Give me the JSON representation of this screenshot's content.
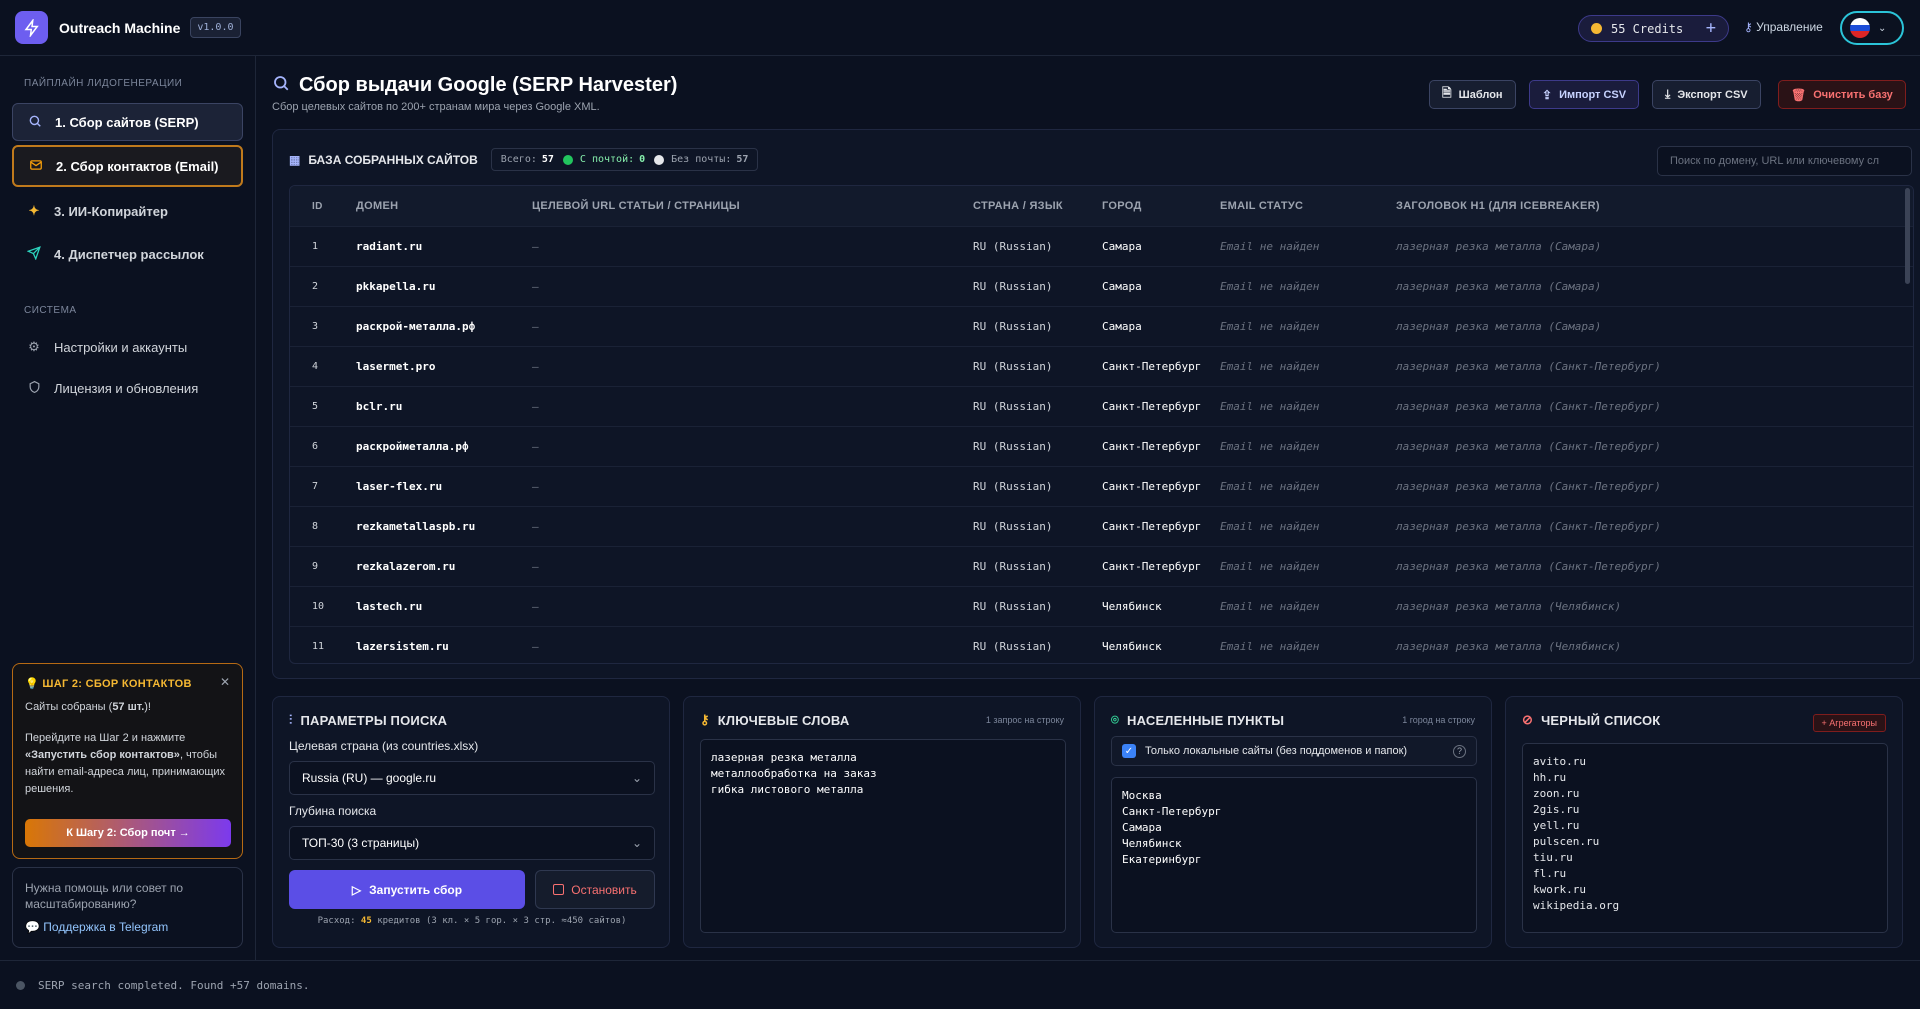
{
  "header": {
    "app_name": "Outreach Machine",
    "version": "v1.0.0",
    "credits": "55 Credits",
    "manage_label": "Управление"
  },
  "sidebar": {
    "pipeline_title": "ПАЙПЛАЙН ЛИДОГЕНЕРАЦИИ",
    "items": [
      {
        "label": "1. Сбор сайтов (SERP)",
        "icon": "search-icon"
      },
      {
        "label": "2. Сбор контактов (Email)",
        "icon": "mail-icon"
      },
      {
        "label": "3. ИИ-Копирайтер",
        "icon": "sparkles-icon"
      },
      {
        "label": "4. Диспетчер рассылок",
        "icon": "send-icon"
      }
    ],
    "system_title": "СИСТЕМА",
    "system_items": [
      {
        "label": "Настройки и аккаунты",
        "icon": "gear-icon"
      },
      {
        "label": "Лицензия и обновления",
        "icon": "shield-icon"
      }
    ],
    "hint": {
      "title": "ШАГ 2: СБОР КОНТАКТОВ",
      "line1": "Сайты собраны (",
      "line1_bold": "57 шт.",
      "line1_end": ")!",
      "line2_a": "Перейдите на Шаг 2 и нажмите ",
      "line2_bold": "«Запустить сбор контактов»",
      "line2_b": ", чтобы найти email-адреса лиц, принимающих решения.",
      "button": "К Шагу 2: Сбор почт →"
    },
    "help": {
      "text": "Нужна помощь или совет по масштабированию?",
      "link": "Поддержка в Telegram"
    }
  },
  "page": {
    "title": "Сбор выдачи Google (SERP Harvester)",
    "subtitle": "Сбор целевых сайтов по 200+ странам мира через Google XML.",
    "buttons": {
      "template": "Шаблон",
      "import": "Импорт CSV",
      "export": "Экспорт CSV",
      "clear": "Очистить базу"
    }
  },
  "table": {
    "title": "БАЗА СОБРАННЫХ САЙТОВ",
    "total_label": "Всего:",
    "total": "57",
    "with_email_label": "С почтой:",
    "with_email": "0",
    "no_email_label": "Без почты:",
    "no_email": "57",
    "search_placeholder": "Поиск по домену, URL или ключевому сл",
    "columns": [
      "ID",
      "ДОМЕН",
      "ЦЕЛЕВОЙ URL СТАТЬИ / СТРАНИЦЫ",
      "СТРАНА / ЯЗЫК",
      "ГОРОД",
      "EMAIL СТАТУС",
      "ЗАГОЛОВОК H1 (ДЛЯ ICEBREAKER)"
    ],
    "rows": [
      {
        "id": "1",
        "domain": "radiant.ru",
        "url": "—",
        "country": "RU (Russian)",
        "city": "Самара",
        "email": "Email не найден",
        "h1": "лазерная резка металла (Самара)"
      },
      {
        "id": "2",
        "domain": "pkkapella.ru",
        "url": "—",
        "country": "RU (Russian)",
        "city": "Самара",
        "email": "Email не найден",
        "h1": "лазерная резка металла (Самара)"
      },
      {
        "id": "3",
        "domain": "раскрой-металла.рф",
        "url": "—",
        "country": "RU (Russian)",
        "city": "Самара",
        "email": "Email не найден",
        "h1": "лазерная резка металла (Самара)"
      },
      {
        "id": "4",
        "domain": "lasermet.pro",
        "url": "—",
        "country": "RU (Russian)",
        "city": "Санкт-Петербург",
        "email": "Email не найден",
        "h1": "лазерная резка металла (Санкт-Петербург)"
      },
      {
        "id": "5",
        "domain": "bclr.ru",
        "url": "—",
        "country": "RU (Russian)",
        "city": "Санкт-Петербург",
        "email": "Email не найден",
        "h1": "лазерная резка металла (Санкт-Петербург)"
      },
      {
        "id": "6",
        "domain": "раскройметалла.рф",
        "url": "—",
        "country": "RU (Russian)",
        "city": "Санкт-Петербург",
        "email": "Email не найден",
        "h1": "лазерная резка металла (Санкт-Петербург)"
      },
      {
        "id": "7",
        "domain": "laser-flex.ru",
        "url": "—",
        "country": "RU (Russian)",
        "city": "Санкт-Петербург",
        "email": "Email не найден",
        "h1": "лазерная резка металла (Санкт-Петербург)"
      },
      {
        "id": "8",
        "domain": "rezkametallaspb.ru",
        "url": "—",
        "country": "RU (Russian)",
        "city": "Санкт-Петербург",
        "email": "Email не найден",
        "h1": "лазерная резка металла (Санкт-Петербург)"
      },
      {
        "id": "9",
        "domain": "rezkalazerom.ru",
        "url": "—",
        "country": "RU (Russian)",
        "city": "Санкт-Петербург",
        "email": "Email не найден",
        "h1": "лазерная резка металла (Санкт-Петербург)"
      },
      {
        "id": "10",
        "domain": "lastech.ru",
        "url": "—",
        "country": "RU (Russian)",
        "city": "Челябинск",
        "email": "Email не найден",
        "h1": "лазерная резка металла (Челябинск)"
      },
      {
        "id": "11",
        "domain": "lazersistem.ru",
        "url": "—",
        "country": "RU (Russian)",
        "city": "Челябинск",
        "email": "Email не найден",
        "h1": "лазерная резка металла (Челябинск)"
      }
    ]
  },
  "params": {
    "title": "ПАРАМЕТРЫ ПОИСКА",
    "country_label": "Целевая страна (из countries.xlsx)",
    "country_value": "Russia (RU) — google.ru",
    "depth_label": "Глубина поиска",
    "depth_value": "ТОП-30 (3 страницы)",
    "run_button": "Запустить сбор",
    "stop_button": "Остановить",
    "cost_prefix": "Расход:",
    "cost_value": "45",
    "cost_suffix": "кредитов (3 кл. × 5 гор. × 3 стр. ≈450 сайтов)"
  },
  "keywords": {
    "title": "КЛЮЧЕВЫЕ СЛОВА",
    "note": "1 запрос на строку",
    "text": "лазерная резка металла\nметаллообработка на заказ\nгибка листового металла"
  },
  "cities": {
    "title": "НАСЕЛЕННЫЕ ПУНКТЫ",
    "note": "1 город на строку",
    "checkbox_label": "Только локальные сайты (без поддоменов и папок)",
    "checkbox_checked": true,
    "text": "Москва\nСанкт-Петербург\nСамара\nЧелябинск\nЕкатеринбург"
  },
  "blacklist": {
    "title": "ЧЕРНЫЙ СПИСОК",
    "tag": "+ Агрегаторы",
    "text": "avito.ru\nhh.ru\nzoon.ru\n2gis.ru\nyell.ru\npulscen.ru\ntiu.ru\nfl.ru\nkwork.ru\nwikipedia.org"
  },
  "status": {
    "message": "SERP search completed. Found +57 domains."
  },
  "colors": {
    "accent": "#5b4ee6",
    "warning": "#f5b833",
    "success": "#22c55e",
    "danger": "#f87171"
  }
}
